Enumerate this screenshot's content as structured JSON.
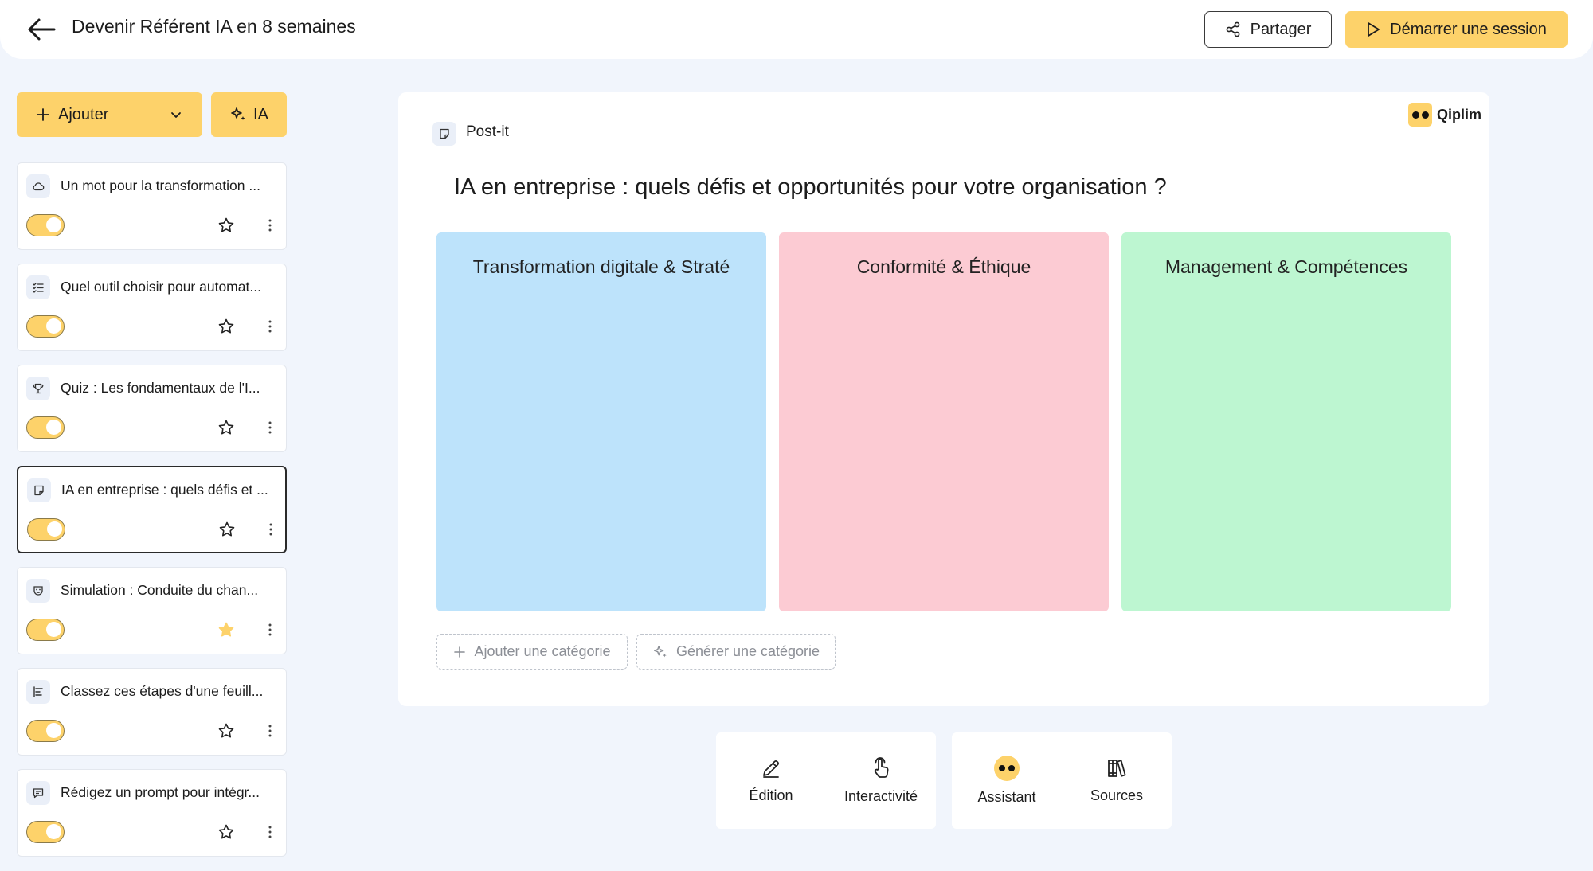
{
  "header": {
    "title": "Devenir Référent IA en 8 semaines",
    "share_label": "Partager",
    "start_label": "Démarrer une session"
  },
  "sidebar": {
    "add_label": "Ajouter",
    "ia_label": "IA",
    "items": [
      {
        "title": "Un mot pour la transformation ...",
        "icon": "cloud-icon",
        "active": true,
        "favorite": false
      },
      {
        "title": "Quel outil choisir pour automat...",
        "icon": "list-check-icon",
        "active": true,
        "favorite": false
      },
      {
        "title": "Quiz : Les fondamentaux de l'I...",
        "icon": "trophy-icon",
        "active": true,
        "favorite": false
      },
      {
        "title": "IA en entreprise : quels défis et ...",
        "icon": "sticky-note-icon",
        "active": true,
        "favorite": false,
        "selected": true
      },
      {
        "title": "Simulation : Conduite du chan...",
        "icon": "theater-mask-icon",
        "active": true,
        "favorite": true
      },
      {
        "title": "Classez ces étapes d'une feuill...",
        "icon": "sort-bars-icon",
        "active": true,
        "favorite": false
      },
      {
        "title": "Rédigez un prompt pour intégr...",
        "icon": "message-icon",
        "active": true,
        "favorite": false
      }
    ]
  },
  "main": {
    "brand": "Qiplim",
    "type_label": "Post-it",
    "question": "IA en entreprise : quels défis et opportunités pour votre organisation ?",
    "categories": [
      {
        "title": "Transformation digitale & Straté",
        "color": "#bde3fb"
      },
      {
        "title": "Conformité & Éthique",
        "color": "#fccbd3"
      },
      {
        "title": "Management & Compétences",
        "color": "#bdf6d1"
      }
    ],
    "add_category_label": "Ajouter une catégorie",
    "generate_category_label": "Générer une catégorie"
  },
  "toolbar": {
    "edition": "Édition",
    "interactivity": "Interactivité",
    "assistant": "Assistant",
    "sources": "Sources"
  },
  "colors": {
    "accent": "#fdd26a",
    "background": "#f1f5fc"
  }
}
